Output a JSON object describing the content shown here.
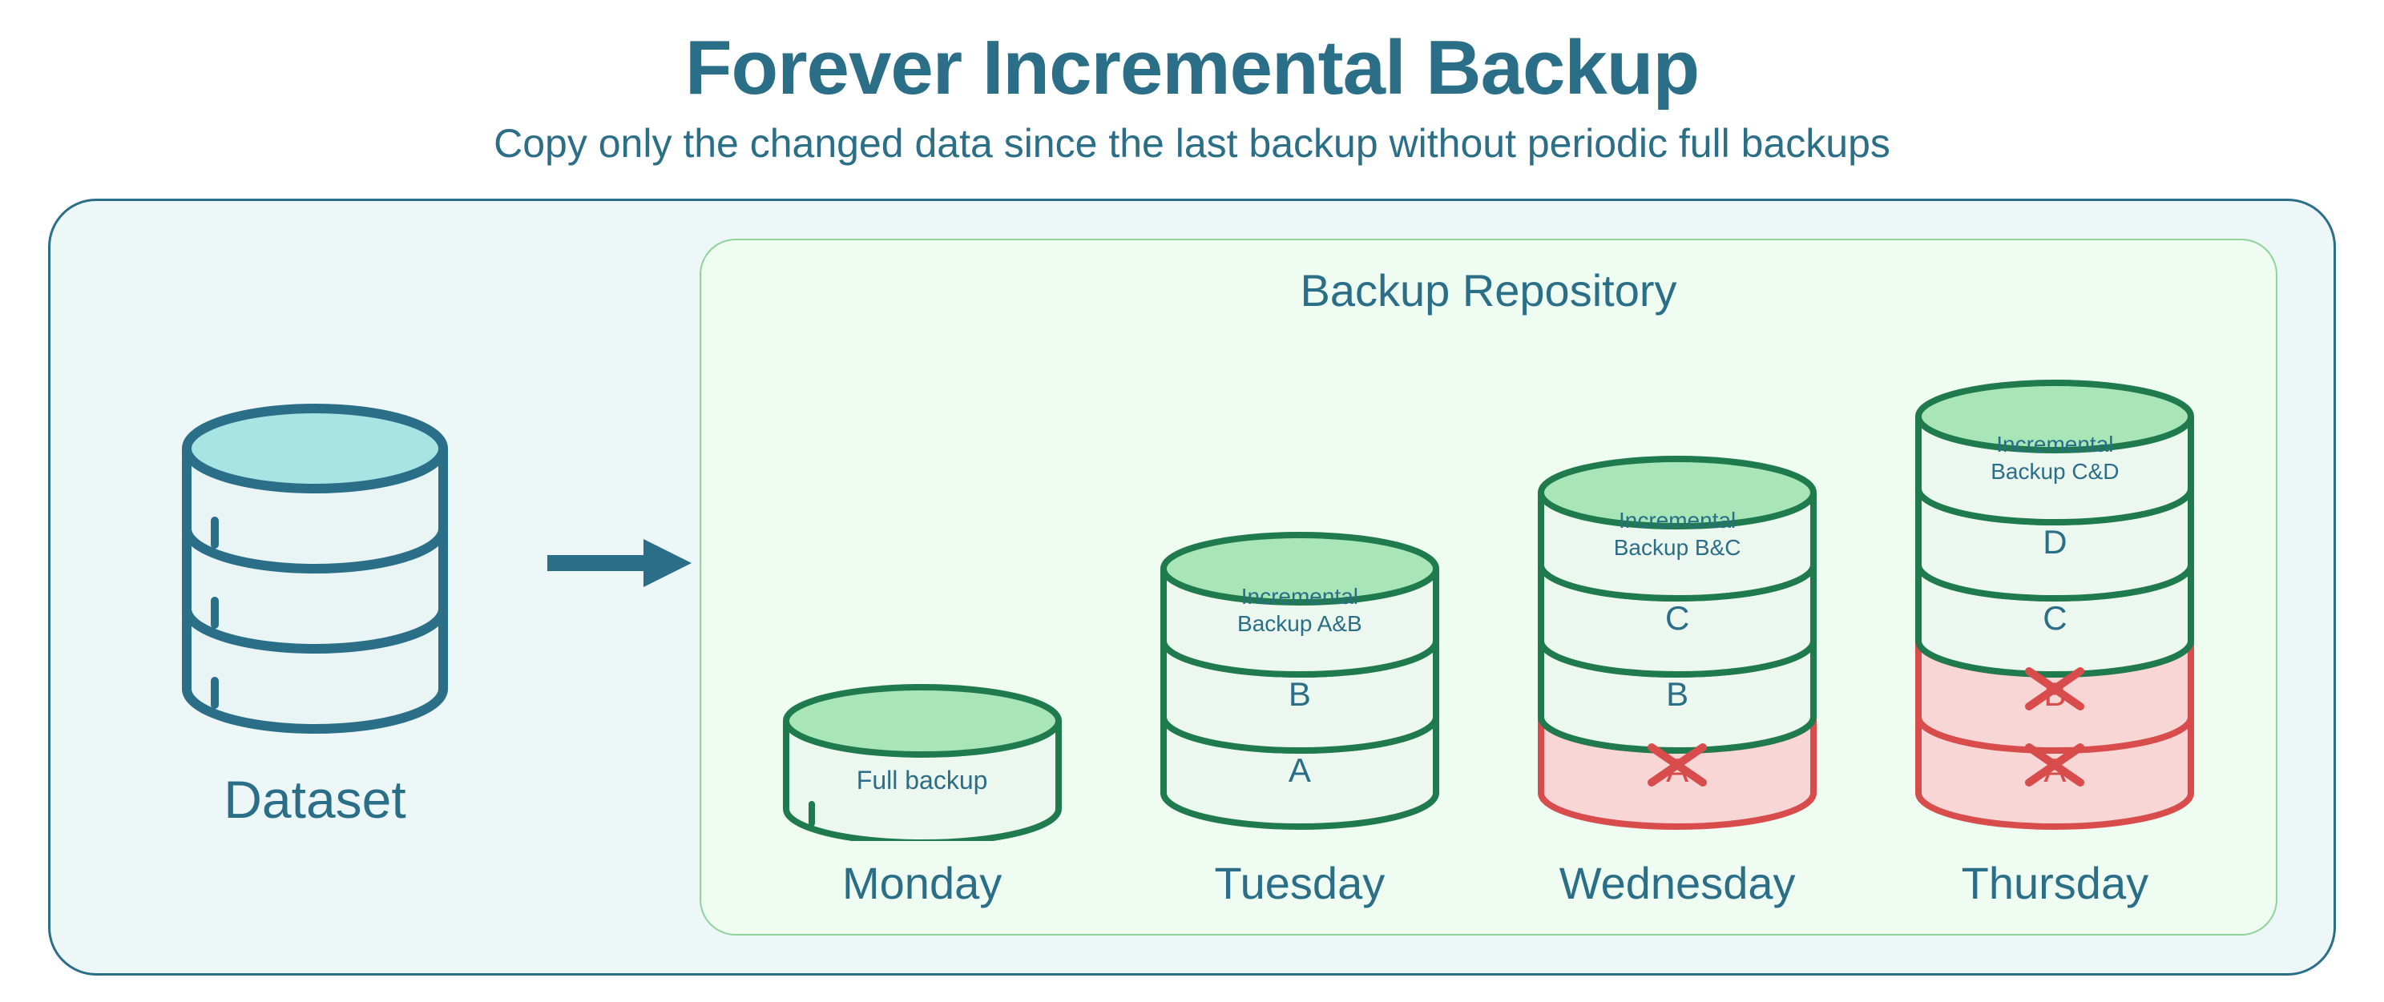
{
  "title": "Forever Incremental Backup",
  "subtitle": "Copy only the changed data since the last backup without periodic full backups",
  "dataset_label": "Dataset",
  "repo_title": "Backup Repository",
  "colors": {
    "primary": "#2b6e87",
    "green_stroke": "#1f7a4d",
    "green_fill_light": "#ecf8ef",
    "green_top": "#a8e6b8",
    "red_stroke": "#d84c4c",
    "red_fill": "#f9d6d6",
    "dataset_top": "#a9e4e4",
    "dataset_fill": "#e9f5f5"
  },
  "days": [
    {
      "label": "Monday",
      "top_label": "Full backup",
      "segments": []
    },
    {
      "label": "Tuesday",
      "top_label": "Incremental\nBackup A&B",
      "segments": [
        {
          "letter": "B",
          "deleted": false
        },
        {
          "letter": "A",
          "deleted": false
        }
      ]
    },
    {
      "label": "Wednesday",
      "top_label": "Incremental\nBackup B&C",
      "segments": [
        {
          "letter": "C",
          "deleted": false
        },
        {
          "letter": "B",
          "deleted": false
        },
        {
          "letter": "A",
          "deleted": true
        }
      ]
    },
    {
      "label": "Thursday",
      "top_label": "Incremental\nBackup C&D",
      "segments": [
        {
          "letter": "D",
          "deleted": false
        },
        {
          "letter": "C",
          "deleted": false
        },
        {
          "letter": "B",
          "deleted": true
        },
        {
          "letter": "A",
          "deleted": true
        }
      ]
    }
  ]
}
